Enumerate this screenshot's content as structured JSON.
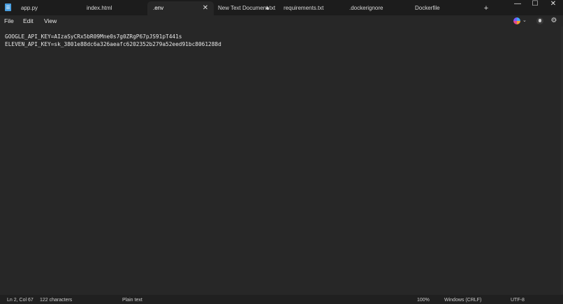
{
  "tabs": [
    {
      "label": "app.py"
    },
    {
      "label": "index.html"
    },
    {
      "label": ".env"
    },
    {
      "label": "New Text Document.txt"
    },
    {
      "label": "requirements.txt"
    },
    {
      "label": ".dockerignore"
    },
    {
      "label": "Dockerfile"
    }
  ],
  "titlebar": {
    "close_tab_glyph": "✕",
    "new_tab_glyph": "+",
    "minimize_glyph": "—",
    "maximize_glyph": "☐",
    "close_glyph": "✕"
  },
  "menu": {
    "file": "File",
    "edit": "Edit",
    "view": "View",
    "copilot_caret": "⌄",
    "settings_glyph": "⚙"
  },
  "editor": {
    "lines": [
      "GOOGLE_API_KEY=AIzaSyCRx5bR09Mne0s7g0ZRgP67pJS91pT441s",
      "ELEVEN_API_KEY=sk_3801e88dc6a326aeafc6202352b279a52eed91bc8061288d"
    ]
  },
  "status": {
    "position": "Ln 2, Col 67",
    "characters": "122 characters",
    "format": "Plain text",
    "zoom": "100%",
    "line_ending": "Windows (CRLF)",
    "encoding": "UTF-8"
  },
  "icons": {
    "app": "notepad-icon",
    "ai": "copilot-icon",
    "account": "profile-icon",
    "settings": "gear-icon"
  },
  "colors": {
    "titlebar": "#1c1c1c",
    "editor_bg": "#272727",
    "statusbar": "#202020",
    "text": "#e8e8e8"
  }
}
